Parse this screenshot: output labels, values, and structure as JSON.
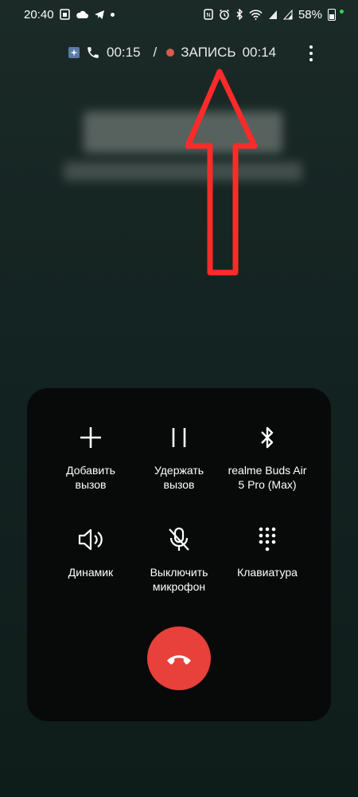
{
  "status_bar": {
    "time": "20:40",
    "battery": "58%",
    "icons": [
      "sim-icon",
      "cloud-icon",
      "telegram-icon",
      "notification-dot-icon",
      "nfc-icon",
      "alarm-icon",
      "bluetooth-icon",
      "wifi-icon",
      "signal-icon",
      "signal-icon",
      "battery-icon"
    ]
  },
  "call": {
    "duration": "00:15",
    "separator": "/",
    "recording_label": "ЗАПИСЬ",
    "recording_time": "00:14"
  },
  "buttons": {
    "add_call": "Добавить\nвызов",
    "hold": "Удержать\nвызов",
    "bluetooth": "realme Buds  Air\n5 Pro (Max)",
    "speaker": "Динамик",
    "mute": "Выключить\nмикрофон",
    "keypad": "Клавиатура"
  },
  "colors": {
    "end_call": "#e8403a",
    "record_dot": "#d95a4f",
    "annotation_arrow": "#ff2a2a"
  }
}
